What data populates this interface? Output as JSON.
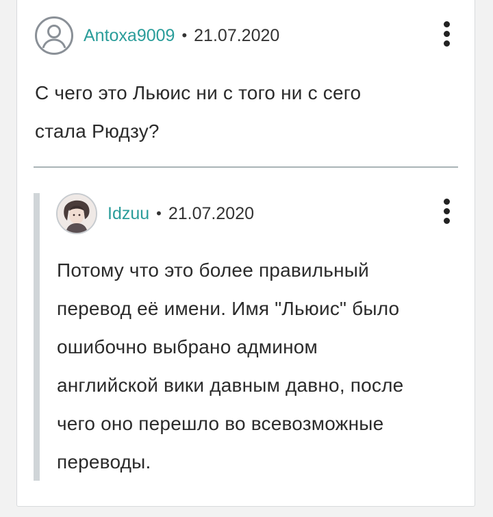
{
  "comments": [
    {
      "author": "Antoxa9009",
      "separator": "•",
      "date": "21.07.2020",
      "avatar_icon": "default-user-icon",
      "text_lines": [
        "С чего это Льюис ни с того ни с сего",
        "стала Рюдзу?"
      ]
    },
    {
      "author": "Idzuu",
      "separator": "•",
      "date": "21.07.2020",
      "avatar_icon": "user-photo-avatar",
      "text_lines": [
        "Потому что это более правильный",
        "перевод её имени. Имя \"Льюис\" было",
        "ошибочно выбрано админом",
        "английской вики давным давно, после",
        "чего оно перешло во всевозможные",
        "переводы."
      ]
    }
  ],
  "colors": {
    "author": "#2a9d9a",
    "text": "#2b2b2b",
    "divider": "#a9b3b6",
    "reply_bar": "#d0d5d8"
  }
}
